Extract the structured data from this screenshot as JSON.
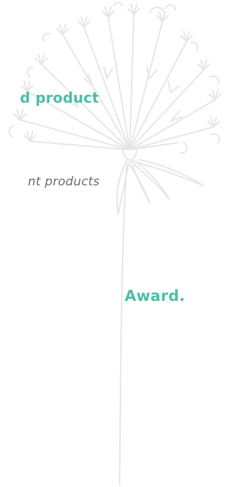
{
  "texts": {
    "heading": "d product",
    "subtitle": "nt products",
    "award": "Award."
  },
  "colors": {
    "accent": "#4dbfa6",
    "subtitle": "#6b6b6b",
    "illustration": "#e6e6e6"
  }
}
